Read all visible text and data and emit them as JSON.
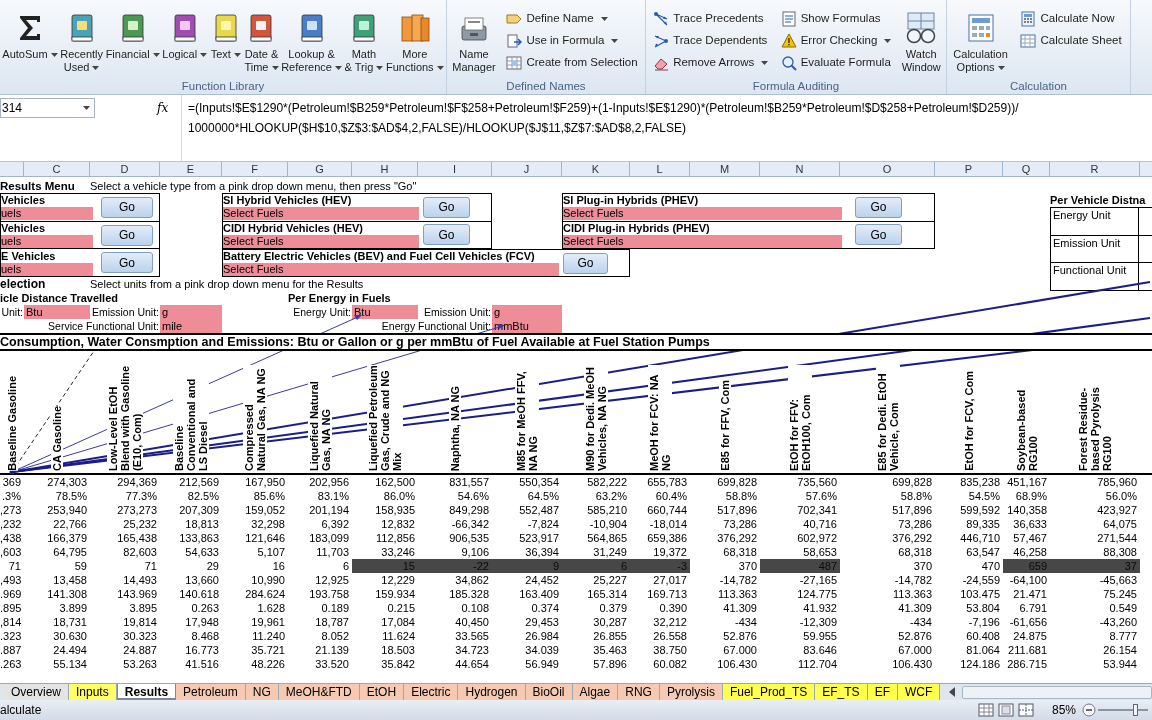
{
  "ribbon": {
    "groups": [
      {
        "label": "Function Library",
        "controls": [
          {
            "kind": "large",
            "lines": [
              "AutoSum"
            ],
            "dropdown": true
          },
          {
            "kind": "large",
            "lines": [
              "Recently",
              "Used"
            ],
            "dropdown": true
          },
          {
            "kind": "large",
            "lines": [
              "Financial"
            ],
            "dropdown": true
          },
          {
            "kind": "large",
            "lines": [
              "Logical"
            ],
            "dropdown": true
          },
          {
            "kind": "large",
            "lines": [
              "Text"
            ],
            "dropdown": true
          },
          {
            "kind": "large",
            "lines": [
              "Date &",
              "Time"
            ],
            "dropdown": true
          },
          {
            "kind": "large",
            "lines": [
              "Lookup &",
              "Reference"
            ],
            "dropdown": true
          },
          {
            "kind": "large",
            "lines": [
              "Math",
              "& Trig"
            ],
            "dropdown": true
          },
          {
            "kind": "large",
            "lines": [
              "More",
              "Functions"
            ],
            "dropdown": true
          }
        ]
      },
      {
        "label": "Defined Names",
        "controls": [
          {
            "kind": "large",
            "lines": [
              "Name",
              "Manager"
            ],
            "dropdown": false
          },
          {
            "kind": "stack",
            "items": [
              {
                "label": "Define Name",
                "dropdown": true
              },
              {
                "label": "Use in Formula",
                "dropdown": true
              },
              {
                "label": "Create from Selection",
                "dropdown": false
              }
            ]
          }
        ]
      },
      {
        "label": "Formula Auditing",
        "controls": [
          {
            "kind": "stack",
            "items": [
              {
                "label": "Trace Precedents",
                "dropdown": false
              },
              {
                "label": "Trace Dependents",
                "dropdown": false
              },
              {
                "label": "Remove Arrows",
                "dropdown": true
              }
            ]
          },
          {
            "kind": "stack",
            "items": [
              {
                "label": "Show Formulas",
                "dropdown": false
              },
              {
                "label": "Error Checking",
                "dropdown": true
              },
              {
                "label": "Evaluate Formula",
                "dropdown": false
              }
            ]
          },
          {
            "kind": "large",
            "lines": [
              "Watch",
              "Window"
            ],
            "dropdown": false
          }
        ]
      },
      {
        "label": "Calculation",
        "controls": [
          {
            "kind": "large",
            "lines": [
              "Calculation",
              "Options"
            ],
            "dropdown": true
          },
          {
            "kind": "stack",
            "items": [
              {
                "label": "Calculate Now",
                "dropdown": false
              },
              {
                "label": "Calculate Sheet",
                "dropdown": false
              }
            ]
          }
        ]
      }
    ]
  },
  "formula_bar": {
    "name_box": "314",
    "fx": "fx",
    "lines": [
      "=(Inputs!$E$1290*(Petroleum!$B259*Petroleum!$F$258+Petroleum!$F259)+(1-Inputs!$E$1290)*(Petroleum!$B259*Petroleum!$D$258+Petroleum!$D259))/",
      "1000000*HLOOKUP($H$10,$Z$3:$AD$4,2,FALSE)/HLOOKUP($J$11,$Z$7:$AD$8,2,FALSE)"
    ]
  },
  "column_headers": [
    "C",
    "D",
    "E",
    "F",
    "G",
    "H",
    "I",
    "J",
    "K",
    "L",
    "M",
    "N",
    "O",
    "P",
    "Q",
    "R"
  ],
  "sheet": {
    "results_menu": {
      "title": "Results Menu",
      "instruction": "Select a vehicle type from a pink drop down menu, then press \"Go\""
    },
    "vehicle_groups": [
      {
        "items": [
          {
            "title": "Vehicles",
            "field": "uels",
            "button": "Go"
          },
          {
            "title": "Vehicles",
            "field": "uels",
            "button": "Go"
          },
          {
            "title": "E Vehicles",
            "field": "uels",
            "button": "Go"
          }
        ]
      },
      {
        "items": [
          {
            "title": "SI Hybrid Vehicles (HEV)",
            "field": "Select Fuels",
            "button": "Go"
          },
          {
            "title": "CIDI Hybrid Vehicles (HEV)",
            "field": "Select Fuels",
            "button": "Go"
          }
        ]
      },
      {
        "items": [
          {
            "title": "Battery Electric Vehicles (BEV) and Fuel Cell Vehicles (FCV)",
            "field": "Select Fuels",
            "button": "Go"
          }
        ]
      },
      {
        "items": [
          {
            "title": "SI Plug-in Hybrids (PHEV)",
            "field": "Select Fuels",
            "button": "Go"
          },
          {
            "title": "CIDI Plug-in Hybrids (PHEV)",
            "field": "Select Fuels",
            "button": "Go"
          }
        ]
      }
    ],
    "per_vehicle": {
      "title": "Per Vehicle Distna",
      "rows": [
        "Energy Unit",
        "Emission Unit",
        "Functional Unit"
      ]
    },
    "unit_selection": {
      "title": "election",
      "instruction": "Select units from a pink drop down menu for the Results"
    },
    "distance": {
      "title": "icle Distance Travelled",
      "fields": [
        {
          "label": "Unit:",
          "value": "Btu"
        },
        {
          "label": "Emission Unit:",
          "value": "g"
        },
        {
          "label": "Service Functional Unit:",
          "value": "mile"
        }
      ]
    },
    "energy": {
      "title": "Per Energy in Fuels",
      "fields": [
        {
          "label": "Energy Unit:",
          "value": "Btu"
        },
        {
          "label": "Emission Unit:",
          "value": "g"
        },
        {
          "label": "Energy Functional Unit:",
          "value": "mmBtu"
        }
      ]
    },
    "section_title": "Consumption, Water Consmption and Emissions: Btu or Gallon or g per mmBtu of Fuel Available at Fuel Station Pumps",
    "table": {
      "headers": [
        "Baseline Gasoline",
        "CA Gasoline",
        "Low-Level EtOH Blend with Gasoline (E10, Com)",
        "Baseline Conventional and LS Diesel",
        "Compressed Natural Gas, NA NG",
        "Liquefied Natural Gas, NA NG",
        "Liquefied Petroleum Gas, Crude and NG Mix",
        "Naphtha, NA NG",
        "M85 for MeOH FFV, NA NG",
        "M90 for Dedi. MeOH Vehicles, NA NG",
        "MeOH for FCV: NA NG",
        "E85 for FFV, Com",
        "EtOH for FFV: EtOH100, Com",
        "E85 for Dedi. EtOH Vehicle, Com",
        "EtOH for FCV, Com",
        "Soybean-based RG100",
        "Forest Residue-based Pyrolysis RG100"
      ],
      "rows": [
        [
          "369",
          "274,303",
          "294,369",
          "212,569",
          "167,950",
          "202,956",
          "162,500",
          "831,557",
          "550,354",
          "582,222",
          "655,783",
          "699,828",
          "735,560",
          "699,828",
          "835,238",
          "451,167",
          "785,960"
        ],
        [
          ".3%",
          "78.5%",
          "77.3%",
          "82.5%",
          "85.6%",
          "83.1%",
          "86.0%",
          "54.6%",
          "64.5%",
          "63.2%",
          "60.4%",
          "58.8%",
          "57.6%",
          "58.8%",
          "54.5%",
          "68.9%",
          "56.0%"
        ],
        [
          ",273",
          "253,940",
          "273,273",
          "207,309",
          "159,052",
          "201,194",
          "158,935",
          "849,298",
          "552,487",
          "585,210",
          "660,744",
          "517,896",
          "702,341",
          "517,896",
          "599,592",
          "140,358",
          "423,927"
        ],
        [
          ",232",
          "22,766",
          "25,232",
          "18,813",
          "32,298",
          "6,392",
          "12,832",
          "-66,342",
          "-7,824",
          "-10,904",
          "-18,014",
          "73,286",
          "40,716",
          "73,286",
          "89,335",
          "36,633",
          "64,075"
        ],
        [
          ",438",
          "166,379",
          "165,438",
          "133,863",
          "121,646",
          "183,099",
          "112,856",
          "906,535",
          "523,917",
          "564,865",
          "659,386",
          "376,292",
          "602,972",
          "376,292",
          "446,710",
          "57,467",
          "271,544"
        ],
        [
          ",603",
          "64,795",
          "82,603",
          "54,633",
          "5,107",
          "11,703",
          "33,246",
          "9,106",
          "36,394",
          "31,249",
          "19,372",
          "68,318",
          "58,653",
          "68,318",
          "63,547",
          "46,258",
          "88,308"
        ],
        [
          {
            "value": "71",
            "shaded": false
          },
          {
            "value": "59",
            "shaded": false
          },
          {
            "value": "71",
            "shaded": false
          },
          {
            "value": "29",
            "shaded": false
          },
          {
            "value": "16",
            "shaded": false
          },
          {
            "value": "6",
            "shaded": false
          },
          {
            "value": "15",
            "shaded": true
          },
          {
            "value": "-22",
            "shaded": true
          },
          {
            "value": "9",
            "shaded": true
          },
          {
            "value": "6",
            "shaded": true
          },
          {
            "value": "-3",
            "shaded": true
          },
          {
            "value": "370",
            "shaded": false
          },
          {
            "value": "487",
            "shaded": true
          },
          {
            "value": "370",
            "shaded": false
          },
          {
            "value": "470",
            "shaded": false
          },
          {
            "value": "659",
            "shaded": true
          },
          {
            "value": "37",
            "shaded": true
          }
        ],
        [
          ",493",
          "13,458",
          "14,493",
          "13,660",
          "10,990",
          "12,925",
          "12,229",
          "34,862",
          "24,452",
          "25,227",
          "27,017",
          "-14,782",
          "-27,165",
          "-14,782",
          "-24,559",
          "-64,100",
          "-45,663"
        ],
        [
          ".969",
          "141.308",
          "143.969",
          "140.618",
          "284.624",
          "193.758",
          "159.934",
          "185.328",
          "163.409",
          "165.314",
          "169.713",
          "113.363",
          "124.775",
          "113.363",
          "103.475",
          "21.471",
          "75.245"
        ],
        [
          ".895",
          "3.899",
          "3.895",
          "0.263",
          "1.628",
          "0.189",
          "0.215",
          "0.108",
          "0.374",
          "0.379",
          "0.390",
          "41.309",
          "41.932",
          "41.309",
          "53.804",
          "6.791",
          "0.549"
        ],
        [
          ",814",
          "18,731",
          "19,814",
          "17,948",
          "19,961",
          "18,787",
          "17,084",
          "40,450",
          "29,453",
          "30,287",
          "32,212",
          "-434",
          "-12,309",
          "-434",
          "-7,196",
          "-61,656",
          "-43,260"
        ],
        [
          ".323",
          "30.630",
          "30.323",
          "8.468",
          "11.240",
          "8.052",
          "11.624",
          "33.565",
          "26.984",
          "26.855",
          "26.558",
          "52.876",
          "59.955",
          "52.876",
          "60.408",
          "24.875",
          "8.777"
        ],
        [
          ".887",
          "24.494",
          "24.887",
          "16.773",
          "35.721",
          "21.139",
          "18.503",
          "34.723",
          "34.039",
          "35.463",
          "38.750",
          "67.000",
          "83.646",
          "67.000",
          "81.064",
          "211.681",
          "26.154"
        ],
        [
          ".263",
          "55.134",
          "53.263",
          "41.516",
          "48.226",
          "33.520",
          "35.842",
          "44.654",
          "56.949",
          "57.896",
          "60.082",
          "106.430",
          "112.704",
          "106.430",
          "124.186",
          "286.715",
          "53.944"
        ]
      ]
    }
  },
  "sheet_tabs": [
    {
      "label": "Overview",
      "selected": false,
      "color": "#e4e4e4"
    },
    {
      "label": "Inputs",
      "selected": false,
      "color": "#ffff66"
    },
    {
      "label": "Results",
      "selected": true,
      "color": "#ffffff"
    },
    {
      "label": "Petroleum",
      "selected": false,
      "color": "#f6c9b2"
    },
    {
      "label": "NG",
      "selected": false,
      "color": "#f6c9b2"
    },
    {
      "label": "MeOH&FTD",
      "selected": false,
      "color": "#f6c9b2"
    },
    {
      "label": "EtOH",
      "selected": false,
      "color": "#f6c9b2"
    },
    {
      "label": "Electric",
      "selected": false,
      "color": "#f6c9b2"
    },
    {
      "label": "Hydrogen",
      "selected": false,
      "color": "#f6c9b2"
    },
    {
      "label": "BioOil",
      "selected": false,
      "color": "#f6c9b2"
    },
    {
      "label": "Algae",
      "selected": false,
      "color": "#f6c9b2"
    },
    {
      "label": "RNG",
      "selected": false,
      "color": "#f6c9b2"
    },
    {
      "label": "Pyrolysis",
      "selected": false,
      "color": "#f6c9b2"
    },
    {
      "label": "Fuel_Prod_TS",
      "selected": false,
      "color": "#ffff4d"
    },
    {
      "label": "EF_TS",
      "selected": false,
      "color": "#ffff4d"
    },
    {
      "label": "EF",
      "selected": false,
      "color": "#ffff4d"
    },
    {
      "label": "WCF",
      "selected": false,
      "color": "#ffff4d"
    }
  ],
  "status_bar": {
    "mode": "alculate",
    "zoom": {
      "reading": "85%",
      "level": 0.74
    }
  }
}
